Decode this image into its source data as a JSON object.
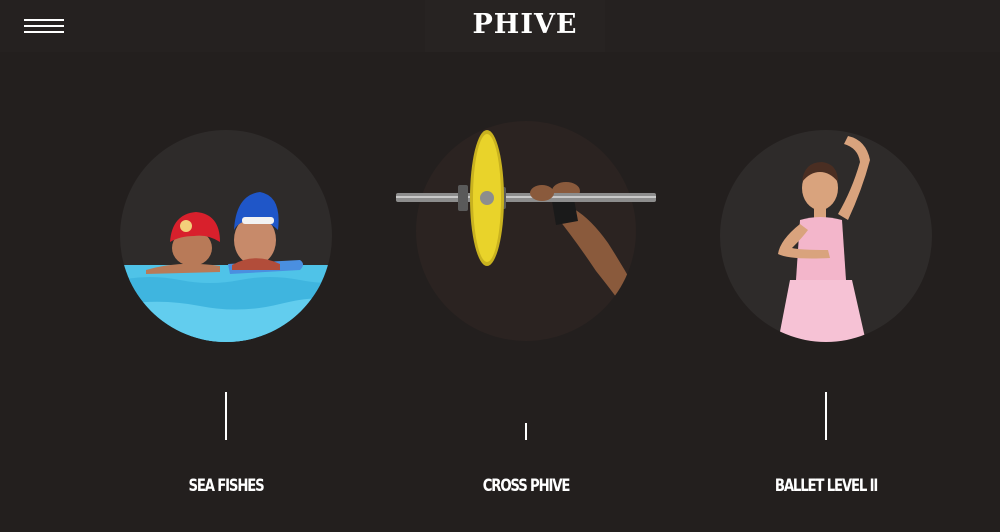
{
  "header": {
    "logo": "PHIVE",
    "menu_icon": "hamburger-menu-icon"
  },
  "programs": [
    {
      "label": "SEA FISHES",
      "image": "swimming-lesson-photo"
    },
    {
      "label": "CROSS PHIVE",
      "image": "barbell-lift-photo"
    },
    {
      "label": "BALLET LEVEL II",
      "image": "ballet-girl-photo"
    }
  ],
  "colors": {
    "background": "#231f1e",
    "circle": "#2e2b2a",
    "text": "#ffffff",
    "plate": "#e9d32a",
    "water": "#4fc3e8"
  }
}
